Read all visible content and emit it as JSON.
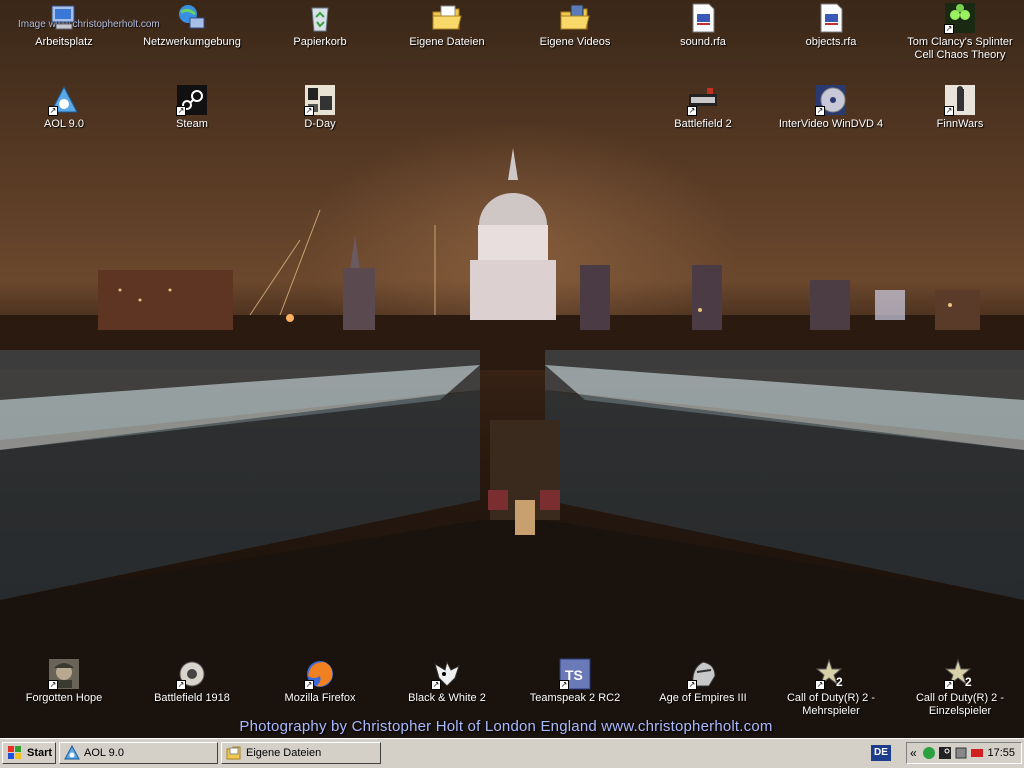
{
  "desktop": {
    "watermark": "Image www.christopherholt.com",
    "credit": "Photography by Christopher Holt of London England www.christopherholt.com",
    "icons_row1": [
      {
        "label": "Arbeitsplatz",
        "icon": "my-computer-icon"
      },
      {
        "label": "Netzwerkumgebung",
        "icon": "network-places-icon"
      },
      {
        "label": "Papierkorb",
        "icon": "recycle-bin-icon"
      },
      {
        "label": "Eigene Dateien",
        "icon": "my-documents-icon"
      },
      {
        "label": "Eigene Videos",
        "icon": "my-videos-icon"
      },
      {
        "label": "sound.rfa",
        "icon": "file-icon"
      },
      {
        "label": "objects.rfa",
        "icon": "file-icon"
      },
      {
        "label": "Tom Clancy's Splinter Cell Chaos Theory",
        "icon": "splinter-cell-icon"
      }
    ],
    "icons_row2": [
      {
        "label": "AOL 9.0",
        "icon": "aol-icon"
      },
      {
        "label": "Steam",
        "icon": "steam-icon"
      },
      {
        "label": "D-Day",
        "icon": "dday-icon"
      },
      {
        "label": "Battlefield 2",
        "icon": "battlefield2-icon"
      },
      {
        "label": "InterVideo WinDVD 4",
        "icon": "windvd-icon"
      },
      {
        "label": "FinnWars",
        "icon": "finnwars-icon"
      }
    ],
    "icons_bottom": [
      {
        "label": "Forgotten Hope",
        "icon": "forgotten-hope-icon"
      },
      {
        "label": "Battlefield 1918",
        "icon": "battlefield1918-icon"
      },
      {
        "label": "Mozilla Firefox",
        "icon": "firefox-icon"
      },
      {
        "label": "Black & White 2",
        "icon": "black-white-2-icon"
      },
      {
        "label": "Teamspeak 2 RC2",
        "icon": "teamspeak-icon"
      },
      {
        "label": "Age of Empires III",
        "icon": "age-of-empires-icon"
      },
      {
        "label": "Call of Duty(R) 2 - Mehrspieler",
        "icon": "call-of-duty-icon"
      },
      {
        "label": "Call of Duty(R) 2 - Einzelspieler",
        "icon": "call-of-duty-icon"
      }
    ]
  },
  "taskbar": {
    "start_label": "Start",
    "tasks": [
      {
        "label": "AOL 9.0",
        "icon": "aol-icon"
      },
      {
        "label": "Eigene Dateien",
        "icon": "folder-icon"
      }
    ],
    "language": "DE",
    "tray_chevron": "«",
    "clock": "17:55"
  }
}
